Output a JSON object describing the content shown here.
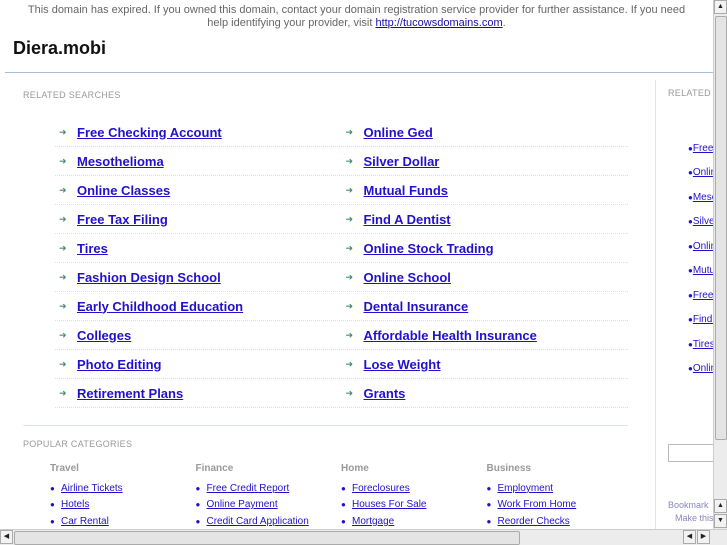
{
  "notice": {
    "text": "This domain has expired. If you owned this domain, contact your domain registration service provider for further assistance. If you need help identifying your provider, visit ",
    "link": "http://tucowsdomains.com",
    "suffix": "."
  },
  "site_title": "Diera.mobi",
  "related_label": "RELATED SEARCHES",
  "related": [
    [
      "Free Checking Account",
      "Online Ged"
    ],
    [
      "Mesothelioma",
      "Silver Dollar"
    ],
    [
      "Online Classes",
      "Mutual Funds"
    ],
    [
      "Free Tax Filing",
      "Find A Dentist"
    ],
    [
      "Tires",
      "Online Stock Trading"
    ],
    [
      "Fashion Design School",
      "Online School"
    ],
    [
      "Early Childhood Education",
      "Dental Insurance"
    ],
    [
      "Colleges",
      "Affordable Health Insurance"
    ],
    [
      "Photo Editing",
      "Lose Weight"
    ],
    [
      "Retirement Plans",
      "Grants"
    ]
  ],
  "popular_label": "POPULAR CATEGORIES",
  "categories": [
    {
      "title": "Travel",
      "items": [
        "Airline Tickets",
        "Hotels",
        "Car Rental"
      ]
    },
    {
      "title": "Finance",
      "items": [
        "Free Credit Report",
        "Online Payment",
        "Credit Card Application"
      ]
    },
    {
      "title": "Home",
      "items": [
        "Foreclosures",
        "Houses For Sale",
        "Mortgage"
      ]
    },
    {
      "title": "Business",
      "items": [
        "Employment",
        "Work From Home",
        "Reorder Checks"
      ]
    }
  ],
  "sidebar": {
    "label": "RELATED",
    "items": [
      "Free Checking Account",
      "Online Ged",
      "Mesothelioma",
      "Silver Dollar",
      "Online Classes",
      "Mutual Funds",
      "Free Tax Filing",
      "Find A Dentist",
      "Tires",
      "Online School"
    ],
    "bookmark": "Bookmark",
    "make": "Make this"
  }
}
